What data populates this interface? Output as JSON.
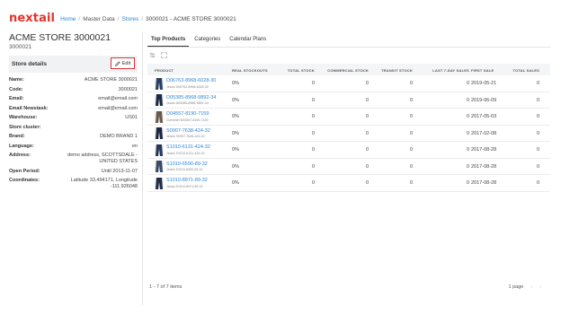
{
  "app": {
    "logo": "nextail"
  },
  "breadcrumb": [
    {
      "label": "Home",
      "link": true
    },
    {
      "label": "Master Data",
      "link": false
    },
    {
      "label": "Stores",
      "link": true
    },
    {
      "label": "3000021 - ACME STORE 3000021",
      "link": false
    }
  ],
  "store": {
    "name": "ACME STORE 3000021",
    "code": "3000021"
  },
  "details": {
    "title": "Store details",
    "edit_label": "Edit",
    "fields": [
      {
        "label": "Name:",
        "value": "ACME STORE 3000021"
      },
      {
        "label": "Code:",
        "value": "3000021"
      },
      {
        "label": "Email:",
        "value": "email@email.com"
      },
      {
        "label": "Email Newstask:",
        "value": "email@email.com"
      },
      {
        "label": "Warehouse:",
        "value": "US01"
      },
      {
        "label": "Store cluster:",
        "value": ""
      },
      {
        "label": "Brand:",
        "value": "DEMO BRAND 1"
      },
      {
        "label": "Language:",
        "value": "en"
      },
      {
        "label": "Address:",
        "value": "demo address, SCOTTSDALE - UNITED STATES"
      },
      {
        "label": "Open Period:",
        "value": "Until 2013-11-07"
      },
      {
        "label": "Coordinates:",
        "value": "Latitude 33.494171, Longitude -111.926048"
      }
    ]
  },
  "tabs": [
    {
      "label": "Top Products",
      "active": true
    },
    {
      "label": "Categories",
      "active": false
    },
    {
      "label": "Calendar Plans",
      "active": false
    }
  ],
  "table": {
    "columns": [
      "PRODUCT",
      "REAL STOCKOUTS",
      "TOTAL STOCK",
      "COMMERCIAL STOCK",
      "TRANSIT STOCK",
      "LAST 7-DAY SALES",
      "FIRST SALE",
      "TOTAL SALES"
    ],
    "rows": [
      {
        "code": "D06763-8968-6028-30",
        "sub": "Jeans D06763-8968-6028-30",
        "stockouts": "0%",
        "total_stock": "0",
        "commercial_stock": "0",
        "transit_stock": "0",
        "last7": "0",
        "first_sale": "2019-05-21",
        "total_sales": "0",
        "thumb_color": "#2b3f66"
      },
      {
        "code": "D05385-8968-9892-34",
        "sub": "Jeans D05385-8968-9892-34",
        "stockouts": "0%",
        "total_stock": "0",
        "commercial_stock": "0",
        "transit_stock": "0",
        "last7": "0",
        "first_sale": "2019-06-09",
        "total_sales": "0",
        "thumb_color": "#1e2a44"
      },
      {
        "code": "D04557-8190-7159",
        "sub": "Overshirt D04557-8190-7159",
        "stockouts": "0%",
        "total_stock": "0",
        "commercial_stock": "0",
        "transit_stock": "0",
        "last7": "0",
        "first_sale": "2017-05-03",
        "total_sales": "0",
        "thumb_color": "#6b5a4a"
      },
      {
        "code": "S0907-7638-424-32",
        "sub": "Jeans S0907-7638-424-32",
        "stockouts": "0%",
        "total_stock": "0",
        "commercial_stock": "0",
        "transit_stock": "0",
        "last7": "0",
        "first_sale": "2017-02-08",
        "total_sales": "0",
        "thumb_color": "#1c2640"
      },
      {
        "code": "S1010-6131-424-32",
        "sub": "Jeans S1010-6131-424-32",
        "stockouts": "0%",
        "total_stock": "0",
        "commercial_stock": "0",
        "transit_stock": "0",
        "last7": "0",
        "first_sale": "2017-08-28",
        "total_sales": "0",
        "thumb_color": "#27385c"
      },
      {
        "code": "S1010-6590-89-32",
        "sub": "Jeans S1010-6590-89-32",
        "stockouts": "0%",
        "total_stock": "0",
        "commercial_stock": "0",
        "transit_stock": "0",
        "last7": "0",
        "first_sale": "2017-08-28",
        "total_sales": "0",
        "thumb_color": "#3a4a6a"
      },
      {
        "code": "S1010-8971-89-32",
        "sub": "Jeans S1010-8971-89-32",
        "stockouts": "0%",
        "total_stock": "0",
        "commercial_stock": "0",
        "transit_stock": "0",
        "last7": "0",
        "first_sale": "2017-08-28",
        "total_sales": "0",
        "thumb_color": "#222d48"
      }
    ]
  },
  "footer": {
    "items_info": "1 - 7 of 7 items",
    "page_label": "1 page"
  },
  "colors": {
    "brand": "#e2332e",
    "link": "#2e86d1",
    "edit_border": "#e03131"
  },
  "icons": {
    "edit": "pencil-icon",
    "filter": "filter-settings-icon",
    "expand": "expand-icon",
    "prev": "chevron-left-icon",
    "next": "chevron-right-icon"
  }
}
